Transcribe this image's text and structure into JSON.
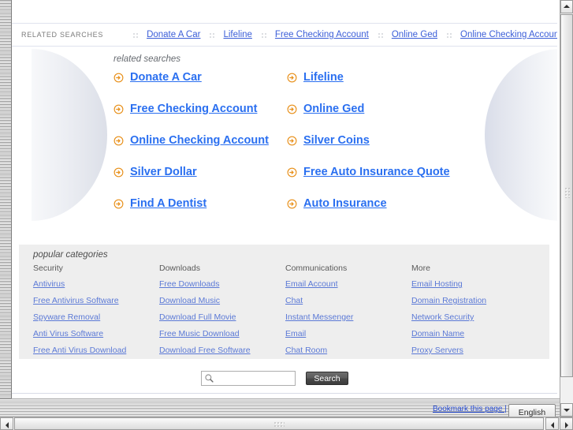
{
  "topbar": {
    "label": "RELATED SEARCHES",
    "links": [
      "Donate A Car",
      "Lifeline",
      "Free Checking Account",
      "Online Ged",
      "Online Checking Account"
    ]
  },
  "related_searches": {
    "heading": "related searches",
    "links": [
      "Donate A Car",
      "Lifeline",
      "Free Checking Account",
      "Online Ged",
      "Online Checking Account",
      "Silver Coins",
      "Silver Dollar",
      "Free Auto Insurance Quote",
      "Find A Dentist",
      "Auto Insurance"
    ]
  },
  "popular_categories": {
    "title": "popular categories",
    "columns": [
      {
        "heading": "Security",
        "links": [
          "Antivirus",
          "Free Antivirus Software",
          "Spyware Removal",
          "Anti Virus Software",
          "Free Anti Virus Download"
        ]
      },
      {
        "heading": "Downloads",
        "links": [
          "Free Downloads",
          "Download Music",
          "Download Full Movie",
          "Free Music Download",
          "Download Free Software"
        ]
      },
      {
        "heading": "Communications",
        "links": [
          "Email Account",
          "Chat",
          "Instant Messenger",
          "Email",
          "Chat Room"
        ]
      },
      {
        "heading": "More",
        "links": [
          "Email Hosting",
          "Domain Registration",
          "Network Security",
          "Domain Name",
          "Proxy Servers"
        ]
      }
    ]
  },
  "search": {
    "value": "",
    "placeholder": "",
    "button_label": "Search",
    "icon": "magnifier-icon"
  },
  "footer": {
    "bookmark_label": "Bookmark this page |",
    "language": "English"
  },
  "icons": {
    "bullet": "circle-arrow-right-icon",
    "dropdown": "chevron-down-icon",
    "scroll_up": "triangle-up-icon",
    "scroll_down": "triangle-down-icon",
    "scroll_left": "triangle-left-icon",
    "scroll_right": "triangle-right-icon"
  },
  "colors": {
    "link_blue": "#2a6ff0",
    "topbar_link": "#3b5ed8",
    "bullet_orange": "#e8901a",
    "category_bg": "#eeeeee",
    "category_link": "#5b79d6"
  }
}
